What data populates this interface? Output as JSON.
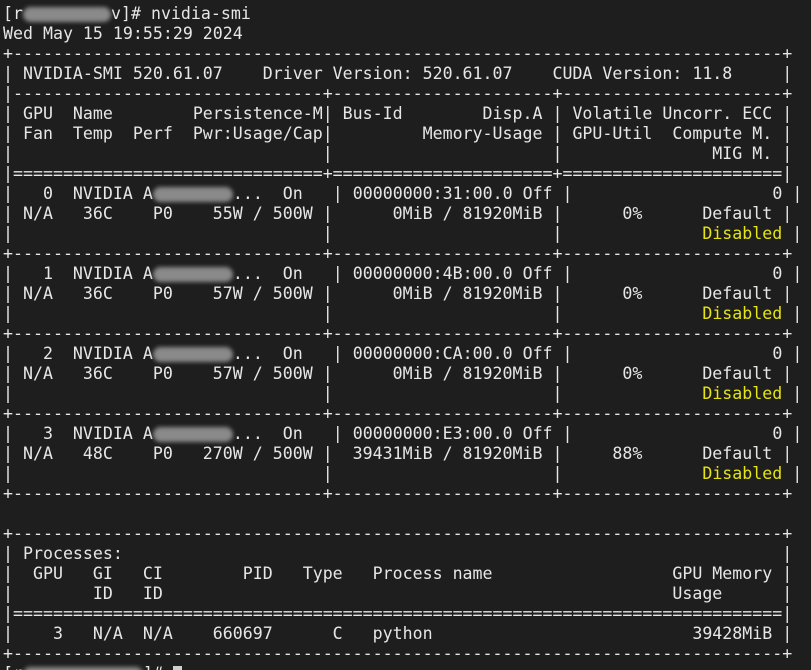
{
  "colors": {
    "background": "#1e1e1e",
    "text": "#e6e6e6",
    "disabled_highlight": "#e5e510"
  },
  "prompt": {
    "open": "[r",
    "close": "v]# ",
    "command": "nvidia-smi"
  },
  "date_line": "Wed May 15 19:55:29 2024",
  "header": {
    "top_border": "+-----------------------------------------------------------------------------+",
    "version_line": "| NVIDIA-SMI 520.61.07    Driver Version: 520.61.07    CUDA Version: 11.8     |",
    "divider": "|-------------------------------+----------------------+----------------------+",
    "col_line_1": "| GPU  Name        Persistence-M| Bus-Id        Disp.A | Volatile Uncorr. ECC |",
    "col_line_2": "| Fan  Temp  Perf  Pwr:Usage/Cap|         Memory-Usage | GPU-Util  Compute M. |",
    "col_line_3": "|                               |                      |               MIG M. |",
    "double_rule": "|===============================+======================+======================|"
  },
  "gpus": [
    {
      "row1_a": "|   0  NVIDIA A",
      "row1_b": "...  On   | 00000000:31:00.0 Off |                    0 |",
      "row2": "| N/A   36C    P0    55W / 500W |      0MiB / 81920MiB |      0%      Default |",
      "row3_a": "|                               |                      |              ",
      "mig": "Disabled",
      "row3_b": " |"
    },
    {
      "row1_a": "|   1  NVIDIA A",
      "row1_b": "...  On   | 00000000:4B:00.0 Off |                    0 |",
      "row2": "| N/A   36C    P0    57W / 500W |      0MiB / 81920MiB |      0%      Default |",
      "row3_a": "|                               |                      |              ",
      "mig": "Disabled",
      "row3_b": " |"
    },
    {
      "row1_a": "|   2  NVIDIA A",
      "row1_b": "...  On   | 00000000:CA:00.0 Off |                    0 |",
      "row2": "| N/A   36C    P0    57W / 500W |      0MiB / 81920MiB |      0%      Default |",
      "row3_a": "|                               |                      |              ",
      "mig": "Disabled",
      "row3_b": " |"
    },
    {
      "row1_a": "|   3  NVIDIA A",
      "row1_b": "...  On   | 00000000:E3:00.0 Off |                    0 |",
      "row2": "| N/A   48C    P0   270W / 500W |  39431MiB / 81920MiB |     88%      Default |",
      "row3_a": "|                               |                      |              ",
      "mig": "Disabled",
      "row3_b": " |"
    }
  ],
  "gpu_separator": "+-------------------------------+----------------------+----------------------+",
  "processes": {
    "top_border": "+-----------------------------------------------------------------------------+",
    "title_line": "| Processes:                                                                  |",
    "col_line_1": "|  GPU   GI   CI        PID   Type   Process name                  GPU Memory |",
    "col_line_2": "|        ID   ID                                                   Usage      |",
    "double_rule": "|=============================================================================|",
    "row": "|    3   N/A  N/A    660697      C   python                          39428MiB |",
    "bottom_border": "+-----------------------------------------------------------------------------+"
  },
  "final_prompt": {
    "open": "[r",
    "tail": "]# "
  }
}
